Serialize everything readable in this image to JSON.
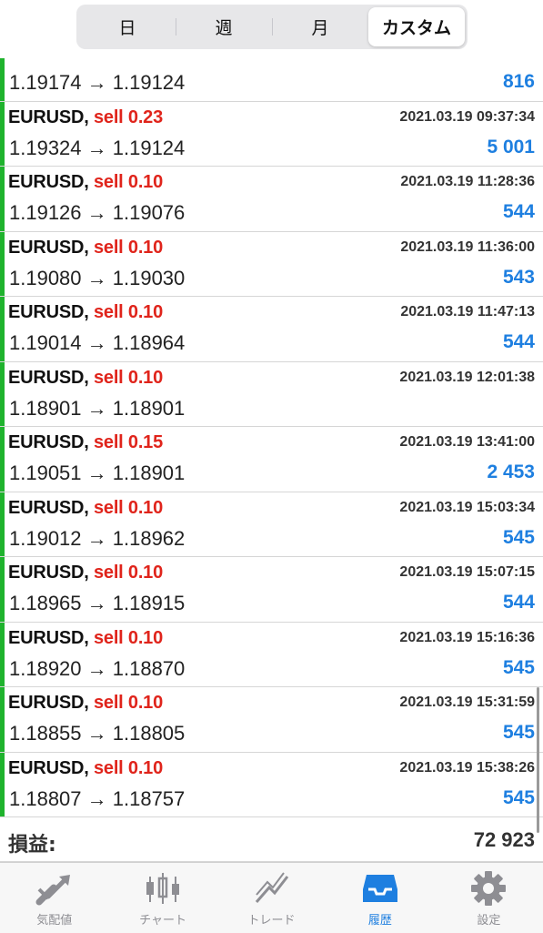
{
  "segments": {
    "day": "日",
    "week": "週",
    "month": "月",
    "custom": "カスタム"
  },
  "partial_row": {
    "prices": "1.19174 → 1.19124",
    "profit": "816"
  },
  "trades": [
    {
      "symbol": "EURUSD,",
      "side": "sell 0.23",
      "time": "2021.03.19 09:37:34",
      "prices": "1.19324 → 1.19124",
      "profit": "5 001"
    },
    {
      "symbol": "EURUSD,",
      "side": "sell 0.10",
      "time": "2021.03.19 11:28:36",
      "prices": "1.19126 → 1.19076",
      "profit": "544"
    },
    {
      "symbol": "EURUSD,",
      "side": "sell 0.10",
      "time": "2021.03.19 11:36:00",
      "prices": "1.19080 → 1.19030",
      "profit": "543"
    },
    {
      "symbol": "EURUSD,",
      "side": "sell 0.10",
      "time": "2021.03.19 11:47:13",
      "prices": "1.19014 → 1.18964",
      "profit": "544"
    },
    {
      "symbol": "EURUSD,",
      "side": "sell 0.10",
      "time": "2021.03.19 12:01:38",
      "prices": "1.18901 → 1.18901",
      "profit": ""
    },
    {
      "symbol": "EURUSD,",
      "side": "sell 0.15",
      "time": "2021.03.19 13:41:00",
      "prices": "1.19051 → 1.18901",
      "profit": "2 453"
    },
    {
      "symbol": "EURUSD,",
      "side": "sell 0.10",
      "time": "2021.03.19 15:03:34",
      "prices": "1.19012 → 1.18962",
      "profit": "545"
    },
    {
      "symbol": "EURUSD,",
      "side": "sell 0.10",
      "time": "2021.03.19 15:07:15",
      "prices": "1.18965 → 1.18915",
      "profit": "544"
    },
    {
      "symbol": "EURUSD,",
      "side": "sell 0.10",
      "time": "2021.03.19 15:16:36",
      "prices": "1.18920 → 1.18870",
      "profit": "545"
    },
    {
      "symbol": "EURUSD,",
      "side": "sell 0.10",
      "time": "2021.03.19 15:31:59",
      "prices": "1.18855 → 1.18805",
      "profit": "545"
    },
    {
      "symbol": "EURUSD,",
      "side": "sell 0.10",
      "time": "2021.03.19 15:38:26",
      "prices": "1.18807 → 1.18757",
      "profit": "545"
    }
  ],
  "summary": {
    "label": "損益:",
    "value": "72 923"
  },
  "tabs": [
    {
      "label": "気配値",
      "icon": "quotes-arrows-icon"
    },
    {
      "label": "チャート",
      "icon": "candlestick-chart-icon"
    },
    {
      "label": "トレード",
      "icon": "trade-line-icon"
    },
    {
      "label": "履歴",
      "icon": "history-inbox-icon"
    },
    {
      "label": "設定",
      "icon": "gear-icon"
    }
  ],
  "colors": {
    "buy_bar": "#1fb32d",
    "sell_text": "#e0241b",
    "profit_text": "#1e7fe0",
    "active_tab": "#1e7fe0",
    "inactive_tab": "#8e8e93"
  }
}
